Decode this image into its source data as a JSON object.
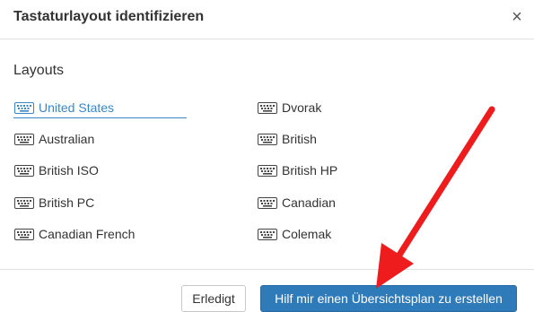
{
  "dialog": {
    "title": "Tastaturlayout identifizieren",
    "close_glyph": "×",
    "section_label": "Layouts",
    "layouts_left": [
      {
        "label": "United States",
        "selected": true
      },
      {
        "label": "Australian",
        "selected": false
      },
      {
        "label": "British ISO",
        "selected": false
      },
      {
        "label": "British PC",
        "selected": false
      },
      {
        "label": "Canadian French",
        "selected": false
      }
    ],
    "layouts_right": [
      {
        "label": "Dvorak",
        "selected": false
      },
      {
        "label": "British",
        "selected": false
      },
      {
        "label": "British HP",
        "selected": false
      },
      {
        "label": "Canadian",
        "selected": false
      },
      {
        "label": "Colemak",
        "selected": false
      }
    ],
    "buttons": {
      "done": "Erledigt",
      "help": "Hilf mir einen Übersichtsplan zu erstellen"
    }
  },
  "icons": {
    "layout_item": "keyboard-icon",
    "close": "close-icon",
    "annotation": "red-arrow-icon"
  },
  "colors": {
    "accent": "#3a87c8",
    "primary_button": "#2f7ab8",
    "annotation_arrow": "#ee1c1c"
  }
}
